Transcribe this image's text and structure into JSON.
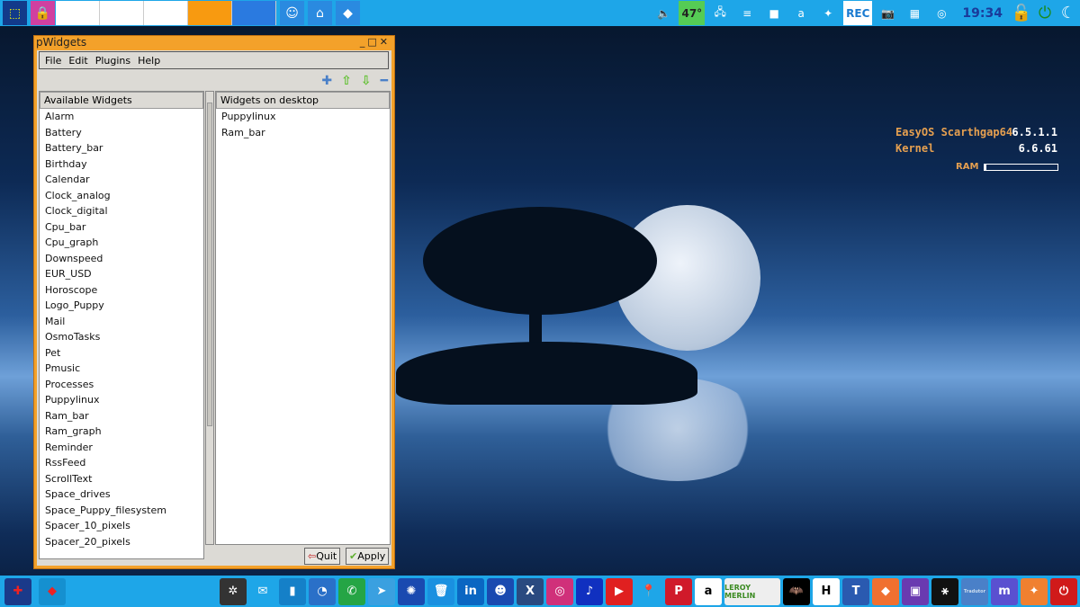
{
  "topbar": {
    "left": [
      {
        "icon": "screenshot-icon",
        "bg": "#123a8a",
        "glyph": "⬚"
      },
      {
        "icon": "lock-icon",
        "bg": "#d040a0",
        "glyph": "🔒"
      }
    ],
    "slots": [
      "",
      "",
      "",
      "",
      ""
    ],
    "apps": [
      {
        "icon": "finder-icon",
        "glyph": "☺"
      },
      {
        "icon": "home-folder-icon",
        "glyph": "⌂"
      },
      {
        "icon": "easyos-cube-icon",
        "glyph": "◆"
      }
    ],
    "tray": [
      {
        "icon": "volume-icon",
        "glyph": "🔈"
      },
      {
        "icon": "temperature-icon",
        "text": "47°"
      },
      {
        "icon": "network-icon",
        "glyph": "🖧"
      },
      {
        "icon": "stack-icon",
        "glyph": "≡"
      },
      {
        "icon": "red-box-icon",
        "glyph": "■"
      },
      {
        "icon": "anydesk-a-icon",
        "glyph": "a"
      },
      {
        "icon": "gimp-icon",
        "glyph": "✦"
      },
      {
        "icon": "rec-icon",
        "text": "REC"
      },
      {
        "icon": "camera-icon",
        "glyph": "📷"
      },
      {
        "icon": "film-icon",
        "glyph": "▦"
      },
      {
        "icon": "target-icon",
        "glyph": "◎"
      }
    ],
    "clock": "19:34",
    "right": [
      {
        "icon": "padlock-icon",
        "glyph": "🔓"
      },
      {
        "icon": "power-icon",
        "glyph": "⏻"
      },
      {
        "icon": "sleep-moon-icon",
        "glyph": "☾"
      }
    ]
  },
  "desktop_info": {
    "os_label": "EasyOS Scarthgap64",
    "os_version": "6.5.1.1",
    "kernel_label": "Kernel",
    "kernel_version": "6.6.61",
    "ram_label": "RAM",
    "ram_fraction": 0.03
  },
  "window": {
    "title": "pWidgets",
    "menu": [
      "File",
      "Edit",
      "Plugins",
      "Help"
    ],
    "toolbar": [
      {
        "icon": "add-icon",
        "glyph": "✚",
        "color": "#4a80c8"
      },
      {
        "icon": "arrow-up-icon",
        "glyph": "⇧",
        "color": "#60c030"
      },
      {
        "icon": "arrow-down-icon",
        "glyph": "⇩",
        "color": "#60c030"
      },
      {
        "icon": "remove-icon",
        "glyph": "━",
        "color": "#4a80c8"
      }
    ],
    "available_header": "Available Widgets",
    "available": [
      "Alarm",
      "Battery",
      "Battery_bar",
      "Birthday",
      "Calendar",
      "Clock_analog",
      "Clock_digital",
      "Cpu_bar",
      "Cpu_graph",
      "Downspeed",
      "EUR_USD",
      "Horoscope",
      "Logo_Puppy",
      "Mail",
      "OsmoTasks",
      "Pet",
      "Pmusic",
      "Processes",
      "Puppylinux",
      "Ram_bar",
      "Ram_graph",
      "Reminder",
      "RssFeed",
      "ScrollText",
      "Space_drives",
      "Space_Puppy_filesystem",
      "Spacer_10_pixels",
      "Spacer_20_pixels"
    ],
    "desktop_header": "Widgets on desktop",
    "desktop": [
      "Puppylinux",
      "Ram_bar"
    ],
    "quit": "Quit",
    "apply": "Apply"
  },
  "bottombar": {
    "left": [
      {
        "icon": "uk-flag-icon",
        "bg": "#1a3a8a",
        "glyph": "✚"
      },
      {
        "icon": "easyos-cube-icon",
        "bg": "#1590d0",
        "glyph": "◆"
      }
    ],
    "apps": [
      {
        "icon": "asterisk-icon",
        "bg": "#333",
        "glyph": "✲"
      },
      {
        "icon": "mail-icon",
        "bg": "#1ea6e8",
        "glyph": "✉"
      },
      {
        "icon": "file-icon",
        "bg": "#1580c8",
        "glyph": "▮"
      },
      {
        "icon": "rss-icon",
        "bg": "#2a70c8",
        "glyph": "◔"
      },
      {
        "icon": "whatsapp-icon",
        "bg": "#25a545",
        "glyph": "✆"
      },
      {
        "icon": "telegram-icon",
        "bg": "#3aa0e0",
        "glyph": "➤"
      },
      {
        "icon": "chatgpt-icon",
        "bg": "#1a4ab0",
        "glyph": "✺"
      },
      {
        "icon": "trash-icon",
        "bg": "#1a90e0",
        "glyph": "🗑"
      },
      {
        "icon": "linkedin-icon",
        "bg": "#0a66c2",
        "text": "in"
      },
      {
        "icon": "puppy-icon",
        "bg": "#1a4ab0",
        "glyph": "☻"
      },
      {
        "icon": "x-icon",
        "bg": "#2a4a80",
        "text": "X"
      },
      {
        "icon": "instagram-icon",
        "bg": "#d0307a",
        "glyph": "◎"
      },
      {
        "icon": "tiktok-icon",
        "bg": "#1030c0",
        "glyph": "♪"
      },
      {
        "icon": "youtube-icon",
        "bg": "#e02020",
        "glyph": "▶"
      },
      {
        "icon": "maps-icon",
        "bg": "#1ea6e8",
        "glyph": "📍"
      },
      {
        "icon": "pinterest-icon",
        "bg": "#d01a2a",
        "text": "P"
      },
      {
        "icon": "amazon-icon",
        "bg": "#fff",
        "text": "a",
        "fg": "#000"
      },
      {
        "icon": "leroy-merlin-icon",
        "bg": "#eee",
        "text": "LEROY MERLIN",
        "fg": "#3a8a20",
        "wide": true
      },
      {
        "icon": "batman-icon",
        "bg": "#000",
        "glyph": "🦇"
      },
      {
        "icon": "h-icon",
        "bg": "#fff",
        "text": "H",
        "fg": "#000"
      },
      {
        "icon": "t-icon",
        "bg": "#2a5ab0",
        "text": "T"
      },
      {
        "icon": "diamond-icon",
        "bg": "#f07030",
        "glyph": "◆"
      },
      {
        "icon": "twitch-icon",
        "bg": "#6a3ab0",
        "glyph": "▣"
      },
      {
        "icon": "graph-icon",
        "bg": "#111",
        "glyph": "⚹"
      },
      {
        "icon": "translator-icon",
        "bg": "#4a80c8",
        "text": "Tradutor",
        "fg": "#cde",
        "small": true
      },
      {
        "icon": "mastodon-icon",
        "bg": "#5a50d0",
        "text": "m"
      },
      {
        "icon": "location-star-icon",
        "bg": "#f08030",
        "glyph": "✦"
      },
      {
        "icon": "shutdown-icon",
        "bg": "#d01a1a",
        "glyph": "⏻"
      }
    ]
  }
}
